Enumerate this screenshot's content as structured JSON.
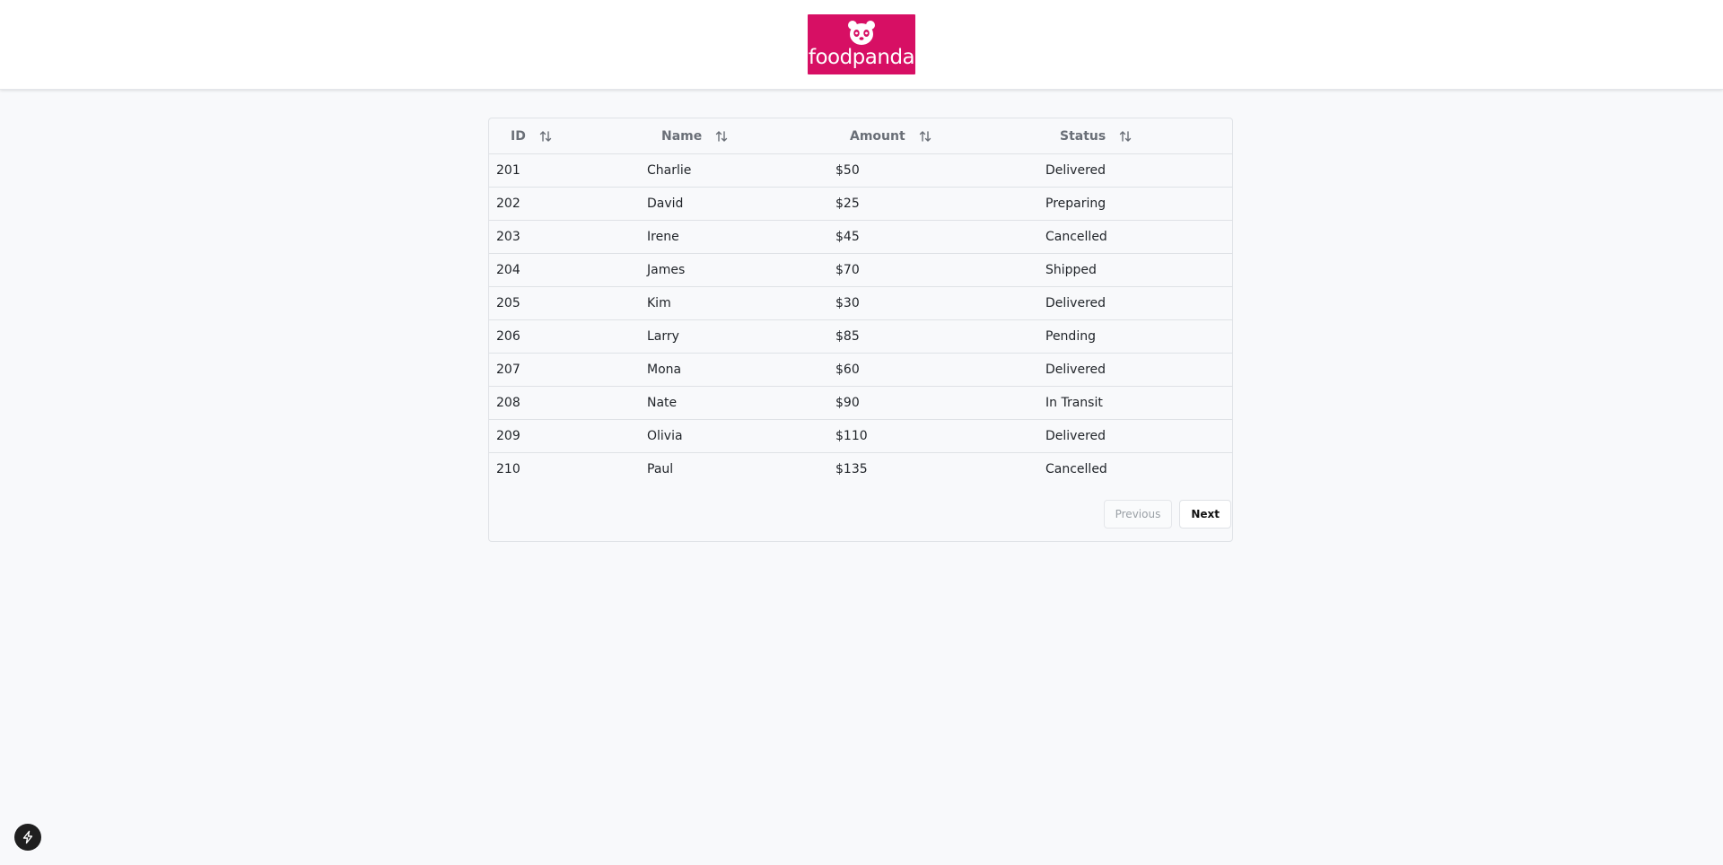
{
  "brand": {
    "logo_text": "foodpanda",
    "logo_color": "#d70f64",
    "panda_icon": "panda-face-icon"
  },
  "table": {
    "columns": [
      {
        "label": "ID",
        "sort_icon": "sort-arrows-icon"
      },
      {
        "label": "Name",
        "sort_icon": "sort-arrows-icon"
      },
      {
        "label": "Amount",
        "sort_icon": "sort-arrows-icon"
      },
      {
        "label": "Status",
        "sort_icon": "sort-arrows-icon"
      }
    ],
    "rows": [
      {
        "id": "201",
        "name": "Charlie",
        "amount": "$50",
        "status": "Delivered"
      },
      {
        "id": "202",
        "name": "David",
        "amount": "$25",
        "status": "Preparing"
      },
      {
        "id": "203",
        "name": "Irene",
        "amount": "$45",
        "status": "Cancelled"
      },
      {
        "id": "204",
        "name": "James",
        "amount": "$70",
        "status": "Shipped"
      },
      {
        "id": "205",
        "name": "Kim",
        "amount": "$30",
        "status": "Delivered"
      },
      {
        "id": "206",
        "name": "Larry",
        "amount": "$85",
        "status": "Pending"
      },
      {
        "id": "207",
        "name": "Mona",
        "amount": "$60",
        "status": "Delivered"
      },
      {
        "id": "208",
        "name": "Nate",
        "amount": "$90",
        "status": "In Transit"
      },
      {
        "id": "209",
        "name": "Olivia",
        "amount": "$110",
        "status": "Delivered"
      },
      {
        "id": "210",
        "name": "Paul",
        "amount": "$135",
        "status": "Cancelled"
      }
    ]
  },
  "pagination": {
    "previous_label": "Previous",
    "next_label": "Next",
    "previous_disabled": true
  },
  "floating_button": {
    "icon": "lightning-bolt-icon"
  }
}
